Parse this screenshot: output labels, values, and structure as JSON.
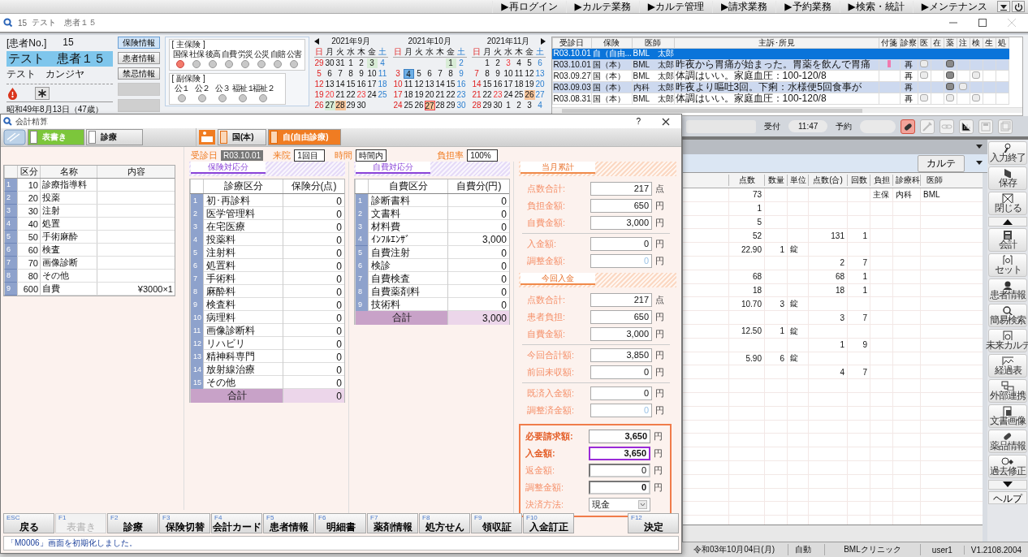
{
  "menu": [
    "▶再ログイン",
    "▶カルテ業務",
    "▶カルテ管理",
    "▶請求業務",
    "▶予約業務",
    "▶検索・統計",
    "▶メンテナンス"
  ],
  "window": {
    "patient_no": "15",
    "patient_name": "テスト　患者１５"
  },
  "patient": {
    "no_label": "[患者No.]",
    "no": "15",
    "name": "テスト　患者１５",
    "kana": "テスト　カンジヤ",
    "birth": "昭和49年8月13日（47歳）"
  },
  "patient_buttons": [
    {
      "label": "保険情報",
      "selected": true
    },
    {
      "label": "患者情報",
      "selected": false
    },
    {
      "label": "禁忌情報",
      "selected": false
    }
  ],
  "insurance": {
    "main_title": "[ 主保険 ]",
    "main": [
      {
        "label": "国保",
        "on": true
      },
      {
        "label": "社保",
        "on": false
      },
      {
        "label": "後高",
        "on": false
      },
      {
        "label": "自費",
        "on": false
      },
      {
        "label": "労災",
        "on": false
      },
      {
        "label": "公災",
        "on": false
      },
      {
        "label": "自賠",
        "on": false
      },
      {
        "label": "公害",
        "on": false
      }
    ],
    "sub_title": "[ 副保険 ]",
    "sub": [
      {
        "label": "公１",
        "on": false
      },
      {
        "label": "公２",
        "on": false
      },
      {
        "label": "公３",
        "on": false
      },
      {
        "label": "福祉１",
        "on": false
      },
      {
        "label": "福祉２",
        "on": false
      }
    ]
  },
  "calendars": [
    {
      "title": "2021年9月",
      "weekdays": [
        "日",
        "月",
        "火",
        "水",
        "木",
        "金",
        "土"
      ],
      "weeks": [
        [
          {
            "day": "29",
            "holiday": false,
            "kind": "plain"
          },
          {
            "day": "30",
            "holiday": false,
            "kind": "plain"
          },
          {
            "day": "31",
            "holiday": false,
            "kind": "plain"
          },
          {
            "day": "1",
            "holiday": false,
            "kind": "plain"
          },
          {
            "day": "2",
            "holiday": false,
            "kind": "plain"
          },
          {
            "day": "3",
            "holiday": false,
            "kind": "visit"
          },
          {
            "day": "4",
            "holiday": false,
            "kind": "plain"
          }
        ],
        [
          {
            "day": "5",
            "holiday": false,
            "kind": "plain"
          },
          {
            "day": "6",
            "holiday": false,
            "kind": "plain"
          },
          {
            "day": "7",
            "holiday": false,
            "kind": "plain"
          },
          {
            "day": "8",
            "holiday": false,
            "kind": "plain"
          },
          {
            "day": "9",
            "holiday": false,
            "kind": "plain"
          },
          {
            "day": "10",
            "holiday": false,
            "kind": "plain"
          },
          {
            "day": "11",
            "holiday": false,
            "kind": "plain"
          }
        ],
        [
          {
            "day": "12",
            "holiday": false,
            "kind": "plain"
          },
          {
            "day": "13",
            "holiday": false,
            "kind": "plain"
          },
          {
            "day": "14",
            "holiday": false,
            "kind": "plain"
          },
          {
            "day": "15",
            "holiday": false,
            "kind": "plain"
          },
          {
            "day": "16",
            "holiday": false,
            "kind": "plain"
          },
          {
            "day": "17",
            "holiday": false,
            "kind": "plain"
          },
          {
            "day": "18",
            "holiday": false,
            "kind": "plain"
          }
        ],
        [
          {
            "day": "19",
            "holiday": false,
            "kind": "plain"
          },
          {
            "day": "20",
            "holiday": true,
            "kind": "plain"
          },
          {
            "day": "21",
            "holiday": false,
            "kind": "plain"
          },
          {
            "day": "22",
            "holiday": false,
            "kind": "plain"
          },
          {
            "day": "23",
            "holiday": true,
            "kind": "plain"
          },
          {
            "day": "24",
            "holiday": false,
            "kind": "plain"
          },
          {
            "day": "25",
            "holiday": false,
            "kind": "plain"
          }
        ],
        [
          {
            "day": "26",
            "holiday": false,
            "kind": "plain"
          },
          {
            "day": "27",
            "holiday": false,
            "kind": "visit"
          },
          {
            "day": "28",
            "holiday": false,
            "kind": "past"
          },
          {
            "day": "29",
            "holiday": false,
            "kind": "plain"
          },
          {
            "day": "30",
            "holiday": false,
            "kind": "plain"
          }
        ]
      ]
    },
    {
      "title": "2021年10月",
      "weekdays": [
        "日",
        "月",
        "火",
        "水",
        "木",
        "金",
        "土"
      ],
      "weeks": [
        [
          {
            "day": "1",
            "holiday": false,
            "kind": "visit"
          },
          {
            "day": "2",
            "holiday": false,
            "kind": "plain"
          }
        ],
        [
          {
            "day": "3",
            "holiday": false,
            "kind": "plain"
          },
          {
            "day": "4",
            "holiday": false,
            "kind": "today"
          },
          {
            "day": "5",
            "holiday": false,
            "kind": "plain"
          },
          {
            "day": "6",
            "holiday": false,
            "kind": "plain"
          },
          {
            "day": "7",
            "holiday": false,
            "kind": "plain"
          },
          {
            "day": "8",
            "holiday": false,
            "kind": "plain"
          },
          {
            "day": "9",
            "holiday": false,
            "kind": "plain"
          }
        ],
        [
          {
            "day": "10",
            "holiday": false,
            "kind": "plain"
          },
          {
            "day": "11",
            "holiday": false,
            "kind": "plain"
          },
          {
            "day": "12",
            "holiday": false,
            "kind": "plain"
          },
          {
            "day": "13",
            "holiday": false,
            "kind": "plain"
          },
          {
            "day": "14",
            "holiday": false,
            "kind": "plain"
          },
          {
            "day": "15",
            "holiday": false,
            "kind": "plain"
          },
          {
            "day": "16",
            "holiday": false,
            "kind": "plain"
          }
        ],
        [
          {
            "day": "17",
            "holiday": false,
            "kind": "plain"
          },
          {
            "day": "18",
            "holiday": false,
            "kind": "plain"
          },
          {
            "day": "19",
            "holiday": false,
            "kind": "plain"
          },
          {
            "day": "20",
            "holiday": false,
            "kind": "plain"
          },
          {
            "day": "21",
            "holiday": false,
            "kind": "plain"
          },
          {
            "day": "22",
            "holiday": false,
            "kind": "plain"
          },
          {
            "day": "23",
            "holiday": false,
            "kind": "plain"
          }
        ],
        [
          {
            "day": "24",
            "holiday": false,
            "kind": "plain"
          },
          {
            "day": "25",
            "holiday": false,
            "kind": "plain"
          },
          {
            "day": "26",
            "holiday": false,
            "kind": "plain"
          },
          {
            "day": "27",
            "holiday": false,
            "kind": "booked"
          },
          {
            "day": "28",
            "holiday": false,
            "kind": "plain"
          },
          {
            "day": "29",
            "holiday": false,
            "kind": "plain"
          },
          {
            "day": "30",
            "holiday": false,
            "kind": "plain"
          }
        ]
      ]
    },
    {
      "title": "2021年11月",
      "weekdays": [
        "日",
        "月",
        "火",
        "水",
        "木",
        "金",
        "土"
      ],
      "weeks": [
        [
          {
            "day": "1",
            "holiday": false,
            "kind": "plain"
          },
          {
            "day": "2",
            "holiday": false,
            "kind": "plain"
          },
          {
            "day": "3",
            "holiday": true,
            "kind": "plain"
          },
          {
            "day": "4",
            "holiday": false,
            "kind": "plain"
          },
          {
            "day": "5",
            "holiday": false,
            "kind": "plain"
          },
          {
            "day": "6",
            "holiday": false,
            "kind": "plain"
          }
        ],
        [
          {
            "day": "7",
            "holiday": false,
            "kind": "plain"
          },
          {
            "day": "8",
            "holiday": false,
            "kind": "plain"
          },
          {
            "day": "9",
            "holiday": false,
            "kind": "plain"
          },
          {
            "day": "10",
            "holiday": false,
            "kind": "plain"
          },
          {
            "day": "11",
            "holiday": false,
            "kind": "plain"
          },
          {
            "day": "12",
            "holiday": false,
            "kind": "plain"
          },
          {
            "day": "13",
            "holiday": false,
            "kind": "plain"
          }
        ],
        [
          {
            "day": "14",
            "holiday": false,
            "kind": "plain"
          },
          {
            "day": "15",
            "holiday": false,
            "kind": "plain"
          },
          {
            "day": "16",
            "holiday": false,
            "kind": "plain"
          },
          {
            "day": "17",
            "holiday": false,
            "kind": "plain"
          },
          {
            "day": "18",
            "holiday": false,
            "kind": "plain"
          },
          {
            "day": "19",
            "holiday": false,
            "kind": "plain"
          },
          {
            "day": "20",
            "holiday": false,
            "kind": "plain"
          }
        ],
        [
          {
            "day": "21",
            "holiday": false,
            "kind": "plain"
          },
          {
            "day": "22",
            "holiday": false,
            "kind": "plain"
          },
          {
            "day": "23",
            "holiday": true,
            "kind": "plain"
          },
          {
            "day": "24",
            "holiday": false,
            "kind": "plain"
          },
          {
            "day": "25",
            "holiday": false,
            "kind": "plain"
          },
          {
            "day": "26",
            "holiday": false,
            "kind": "past"
          },
          {
            "day": "27",
            "holiday": false,
            "kind": "plain"
          }
        ],
        [
          {
            "day": "28",
            "holiday": false,
            "kind": "plain"
          },
          {
            "day": "29",
            "holiday": false,
            "kind": "plain"
          },
          {
            "day": "30",
            "holiday": false,
            "kind": "plain"
          },
          {
            "day": "1",
            "holiday": false,
            "kind": "plain"
          },
          {
            "day": "2",
            "holiday": false,
            "kind": "plain"
          },
          {
            "day": "3",
            "holiday": false,
            "kind": "plain"
          },
          {
            "day": "4",
            "holiday": false,
            "kind": "plain"
          }
        ]
      ]
    }
  ],
  "visits": {
    "columns": [
      "受診日",
      "保険",
      "医師",
      "主訴･所見",
      "付箋",
      "診察",
      "医",
      "在",
      "薬",
      "注",
      "検",
      "生",
      "処"
    ],
    "rows": [
      {
        "selected": true,
        "date": "R03.10.01",
        "ins": "自（自由...",
        "doctor": "BML　太郎",
        "tag": false,
        "dots": [
          {
            "kind": "none"
          },
          {
            "kind": "none"
          },
          {
            "kind": "none"
          },
          {
            "kind": "none"
          },
          {
            "kind": "none"
          },
          {
            "kind": "none"
          },
          {
            "kind": "none"
          }
        ]
      },
      {
        "selected": false,
        "date": "R03.10.01",
        "ins": "国（本）",
        "doctor": "BML　太郎",
        "note": "昨夜から胃痛が始まった。胃薬を飲んで胃痛",
        "tag": true,
        "exam": "再",
        "dots": [
          {
            "kind": "light"
          },
          {
            "kind": "none"
          },
          {
            "kind": "dark"
          },
          {
            "kind": "none"
          },
          {
            "kind": "none"
          },
          {
            "kind": "none"
          },
          {
            "kind": "none"
          }
        ]
      },
      {
        "selected": false,
        "date": "R03.09.27",
        "ins": "国（本）",
        "doctor": "BML　太郎",
        "note": "体調はいい。家庭血圧：100-120/8",
        "tag": false,
        "exam": "再",
        "dots": [
          {
            "kind": "light"
          },
          {
            "kind": "none"
          },
          {
            "kind": "dark"
          },
          {
            "kind": "none"
          },
          {
            "kind": "light"
          },
          {
            "kind": "none"
          },
          {
            "kind": "none"
          }
        ]
      },
      {
        "selected": false,
        "date": "R03.09.03",
        "ins": "国（本）",
        "doctor": "内科　太郎",
        "note": "昨夜より嘔吐3回。下痢：水様便5回食事が",
        "tag": false,
        "exam": "再",
        "dots": [
          {
            "kind": "none"
          },
          {
            "kind": "none"
          },
          {
            "kind": "dark"
          },
          {
            "kind": "light"
          },
          {
            "kind": "none"
          },
          {
            "kind": "none"
          },
          {
            "kind": "none"
          }
        ]
      },
      {
        "selected": false,
        "date": "R03.08.31",
        "ins": "国（本）",
        "doctor": "BML　太郎",
        "note": "体調はいい。家庭血圧：100-120/8",
        "tag": false,
        "exam": "再",
        "dots": [
          {
            "kind": "light"
          },
          {
            "kind": "none"
          },
          {
            "kind": "light"
          },
          {
            "kind": "none"
          },
          {
            "kind": "light"
          },
          {
            "kind": "none"
          },
          {
            "kind": "none"
          }
        ]
      }
    ]
  },
  "reception": {
    "label": "受付",
    "time": "11:47",
    "reserve_label": "予約"
  },
  "tools": [
    {
      "kind": "pill",
      "active": true
    },
    {
      "kind": "syringe",
      "active": false
    },
    {
      "kind": "link",
      "active": false
    },
    {
      "kind": "chart",
      "active": false
    },
    {
      "kind": "save",
      "active": false
    },
    {
      "kind": "stack",
      "active": false
    }
  ],
  "detail": {
    "karte_button": "カルテ",
    "columns": [
      "点数",
      "数量",
      "単位",
      "点数(合)",
      "回数",
      "負担",
      "診療科",
      "医師"
    ],
    "rows": [
      [
        "73",
        null,
        null,
        null,
        null,
        "主保",
        "内科",
        "BML"
      ],
      [
        "1"
      ],
      [
        "5"
      ],
      [
        "52",
        null,
        null,
        "131",
        "1"
      ],
      [
        "22.90",
        "1",
        "錠"
      ],
      [
        null,
        null,
        null,
        "2",
        "7"
      ],
      [
        "68",
        null,
        null,
        "68",
        "1"
      ],
      [
        "18",
        null,
        null,
        "18",
        "1"
      ],
      [
        "10.70",
        "3",
        "錠"
      ],
      [
        null,
        null,
        null,
        "3",
        "7"
      ],
      [
        "12.50",
        "1",
        "錠"
      ],
      [
        null,
        null,
        null,
        "1",
        "9"
      ],
      [
        "5.90",
        "6",
        "錠"
      ],
      [
        null,
        null,
        null,
        "4",
        "7"
      ]
    ]
  },
  "sidebar": [
    {
      "kind": "pen",
      "label": "入力終了"
    },
    {
      "kind": "save",
      "label": "保存"
    },
    {
      "kind": "close",
      "label": "閉じる"
    },
    {
      "kind": "up"
    },
    {
      "kind": "calc",
      "label": "会計"
    },
    {
      "kind": "set",
      "label": "セット"
    },
    {
      "kind": "person",
      "label": "患者情報"
    },
    {
      "kind": "search",
      "label": "簡易検索"
    },
    {
      "kind": "calendar",
      "label": "未来カルテ"
    },
    {
      "kind": "graph",
      "label": "経過表"
    },
    {
      "kind": "network",
      "label": "外部連携"
    },
    {
      "kind": "doc",
      "label": "文書画像"
    },
    {
      "kind": "pill",
      "label": "薬品情報"
    },
    {
      "kind": "history",
      "label": "過去修正"
    },
    {
      "kind": "down"
    },
    {
      "kind": "help",
      "label": "ヘルプ"
    }
  ],
  "status_bar": [
    "令和03年10月04日(月)",
    "自動",
    "BMLクリニック",
    "user1",
    "V1.2108.2004"
  ],
  "dialog": {
    "title": "会計精算",
    "help": "?",
    "tabs_left": [
      {
        "label": "表書き",
        "selected": true
      },
      {
        "label": "診療",
        "selected": false
      }
    ],
    "tabs_right": [
      {
        "label": "国(本)",
        "selected": false
      },
      {
        "label": "自(自由診療)",
        "selected": true
      }
    ],
    "left_table": {
      "columns": [
        "区分",
        "名称",
        "内容"
      ],
      "rows": [
        {
          "no": "1",
          "code": "10",
          "name": "診療指導料"
        },
        {
          "no": "2",
          "code": "20",
          "name": "投薬"
        },
        {
          "no": "3",
          "code": "30",
          "name": "注射"
        },
        {
          "no": "4",
          "code": "40",
          "name": "処置"
        },
        {
          "no": "5",
          "code": "50",
          "name": "手術麻酔"
        },
        {
          "no": "6",
          "code": "60",
          "name": "検査"
        },
        {
          "no": "7",
          "code": "70",
          "name": "画像診断"
        },
        {
          "no": "8",
          "code": "80",
          "name": "その他"
        },
        {
          "no": "9",
          "code": "600",
          "name": "自費",
          "content": "¥3000×1"
        }
      ]
    },
    "header_fields": [
      {
        "label": "受診日",
        "value": "R03.10.01",
        "kind": "dark"
      },
      {
        "label": "来院",
        "value": "1回目",
        "kind": "box"
      },
      {
        "label": "時間",
        "value": "時間内",
        "kind": "box"
      },
      {
        "label": "負担率",
        "value": "100%",
        "kind": "box"
      }
    ],
    "sections": [
      {
        "title": "保険対応分",
        "columns": [
          "診療区分",
          "保険分(点)"
        ],
        "rows": [
          {
            "no": "1",
            "name": "初･再診料",
            "value": "0"
          },
          {
            "no": "2",
            "name": "医学管理料",
            "value": "0"
          },
          {
            "no": "3",
            "name": "在宅医療",
            "value": "0"
          },
          {
            "no": "4",
            "name": "投薬料",
            "value": "0"
          },
          {
            "no": "5",
            "name": "注射料",
            "value": "0"
          },
          {
            "no": "6",
            "name": "処置料",
            "value": "0"
          },
          {
            "no": "7",
            "name": "手術料",
            "value": "0"
          },
          {
            "no": "8",
            "name": "麻酔料",
            "value": "0"
          },
          {
            "no": "9",
            "name": "検査料",
            "value": "0"
          },
          {
            "no": "10",
            "name": "病理料",
            "value": "0"
          },
          {
            "no": "11",
            "name": "画像診断料",
            "value": "0"
          },
          {
            "no": "12",
            "name": "リハビリ",
            "value": "0"
          },
          {
            "no": "13",
            "name": "精神科専門",
            "value": "0"
          },
          {
            "no": "14",
            "name": "放射線治療",
            "value": "0"
          },
          {
            "no": "15",
            "name": "その他",
            "value": "0"
          }
        ],
        "total_label": "合計",
        "total": "0"
      },
      {
        "title": "自費対応分",
        "columns": [
          "自費区分",
          "自費分(円)"
        ],
        "rows": [
          {
            "no": "1",
            "name": "診断書料",
            "value": "0"
          },
          {
            "no": "2",
            "name": "文書料",
            "value": "0"
          },
          {
            "no": "3",
            "name": "材料費",
            "value": "0"
          },
          {
            "no": "4",
            "name": "ｲﾝﾌﾙｴﾝｻﾞ",
            "value": "3,000"
          },
          {
            "no": "5",
            "name": "自費注射",
            "value": "0"
          },
          {
            "no": "6",
            "name": "検診",
            "value": "0"
          },
          {
            "no": "7",
            "name": "自費検査",
            "value": "0"
          },
          {
            "no": "8",
            "name": "自費薬剤料",
            "value": "0"
          },
          {
            "no": "9",
            "name": "技術料",
            "value": "0"
          }
        ],
        "total_label": "合計",
        "total": "3,000"
      }
    ],
    "panels": [
      {
        "title": "当月累計",
        "groups": [
          [
            {
              "label": "点数合計:",
              "value": "217",
              "unit": "点",
              "kind": "normal"
            },
            {
              "label": "負担金額:",
              "value": "650",
              "unit": "円",
              "kind": "normal"
            },
            {
              "label": "自費金額:",
              "value": "3,000",
              "unit": "円",
              "kind": "normal"
            }
          ],
          [
            {
              "label": "入金額:",
              "value": "0",
              "unit": "円",
              "kind": "normal"
            },
            {
              "label": "調整金額:",
              "value": "0",
              "unit": "円",
              "kind": "dim"
            }
          ]
        ]
      },
      {
        "title": "今回入金",
        "groups": [
          [
            {
              "label": "点数合計:",
              "value": "217",
              "unit": "点",
              "kind": "normal"
            },
            {
              "label": "患者負担:",
              "value": "650",
              "unit": "円",
              "kind": "normal"
            },
            {
              "label": "自費金額:",
              "value": "3,000",
              "unit": "円",
              "kind": "normal"
            }
          ],
          [
            {
              "label": "今回合計額:",
              "value": "3,850",
              "unit": "円",
              "kind": "normal"
            },
            {
              "label": "前回未収額:",
              "value": "0",
              "unit": "円",
              "kind": "normal"
            }
          ],
          [
            {
              "label": "既済入金額:",
              "value": "0",
              "unit": "円",
              "kind": "normal"
            },
            {
              "label": "調整済金額:",
              "value": "0",
              "unit": "円",
              "kind": "dim"
            }
          ]
        ]
      }
    ],
    "payment": [
      {
        "label": "必要請求額:",
        "value": "3,650",
        "unit": "円",
        "kind": "strong"
      },
      {
        "label": "入金額:",
        "value": "3,650",
        "unit": "円",
        "kind": "focus"
      },
      {
        "label": "返金額:",
        "value": "0",
        "unit": "円",
        "kind": "sunken"
      },
      {
        "label": "調整金額:",
        "value": "0",
        "unit": "円",
        "kind": "sunkenbold"
      },
      {
        "label": "決済方法:",
        "value": "現金",
        "kind": "select"
      }
    ],
    "fkeys": [
      {
        "key": "ESC",
        "label": "戻る",
        "disabled": false
      },
      {
        "key": "F1",
        "label": "表書き",
        "disabled": true
      },
      {
        "key": "F2",
        "label": "診療",
        "disabled": false
      },
      {
        "key": "F3",
        "label": "保険切替",
        "disabled": false
      },
      {
        "key": "F4",
        "label": "会計カード",
        "disabled": false
      },
      {
        "key": "F5",
        "label": "患者情報",
        "disabled": false
      },
      {
        "key": "F6",
        "label": "明細書",
        "disabled": false
      },
      {
        "key": "F7",
        "label": "薬剤情報",
        "disabled": false
      },
      {
        "key": "F8",
        "label": "処方せん",
        "disabled": false
      },
      {
        "key": "F9",
        "label": "領収証",
        "disabled": false
      },
      {
        "key": "F10",
        "label": "入金訂正",
        "disabled": false
      },
      {
        "key": "F12",
        "label": "決定",
        "disabled": false
      }
    ],
    "message": "「M0006」画面を初期化しました。"
  }
}
